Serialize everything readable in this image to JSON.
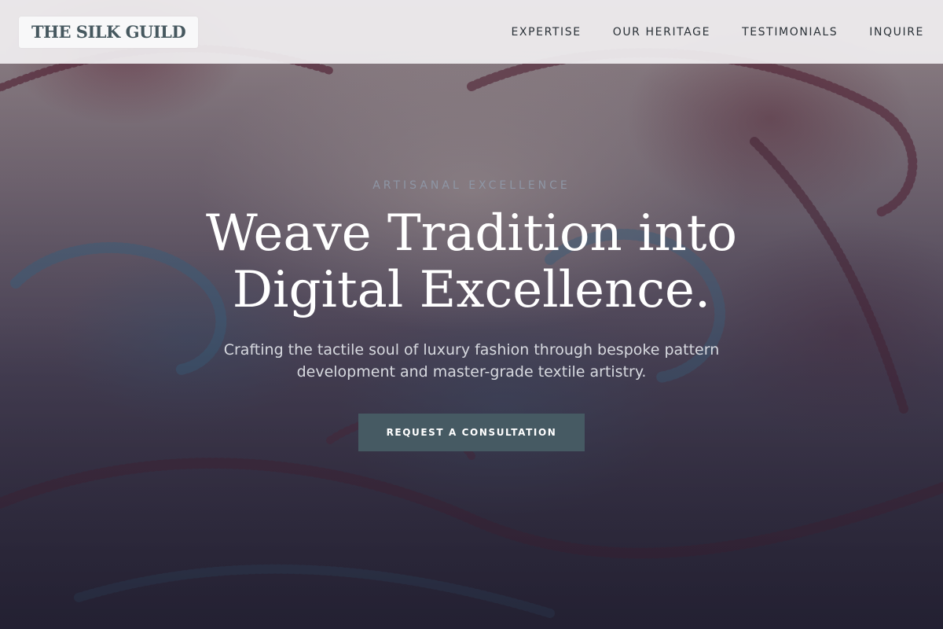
{
  "brand": {
    "name": "THE SILK GUILD"
  },
  "nav": {
    "items": [
      {
        "label": "EXPERTISE"
      },
      {
        "label": "OUR HERITAGE"
      },
      {
        "label": "TESTIMONIALS"
      },
      {
        "label": "INQUIRE"
      }
    ]
  },
  "hero": {
    "eyebrow": "ARTISANAL EXCELLENCE",
    "headline": "Weave Tradition into Digital Excellence.",
    "subhead": "Crafting the tactile soul of luxury fashion through bespoke pattern development and master-grade textile artistry.",
    "cta_label": "REQUEST A CONSULTATION",
    "background_image": "paisley-textile-pattern"
  },
  "colors": {
    "cta_background": "#465a63",
    "logo_text": "#46585f",
    "nav_text": "#2a3137",
    "eyebrow_text": "#8e96a5"
  }
}
